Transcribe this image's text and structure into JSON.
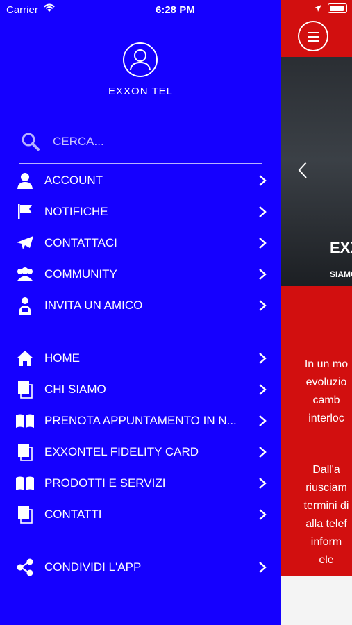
{
  "status": {
    "carrier": "Carrier",
    "time": "6:28 PM"
  },
  "profile": {
    "name": "EXXON TEL"
  },
  "search": {
    "placeholder": "CERCA..."
  },
  "menu": [
    {
      "label": "ACCOUNT",
      "icon": "user-icon"
    },
    {
      "label": "NOTIFICHE",
      "icon": "flag-icon"
    },
    {
      "label": "CONTATTACI",
      "icon": "paper-plane-icon"
    },
    {
      "label": "COMMUNITY",
      "icon": "users-icon"
    },
    {
      "label": "INVITA UN AMICO",
      "icon": "invite-friend-icon"
    },
    {
      "label": "HOME",
      "icon": "home-icon"
    },
    {
      "label": "CHI SIAMO",
      "icon": "pages-icon"
    },
    {
      "label": "PRENOTA APPUNTAMENTO IN N...",
      "icon": "book-icon"
    },
    {
      "label": "EXXONTEL FIDELITY CARD",
      "icon": "pages-icon"
    },
    {
      "label": "PRODOTTI E SERVIZI",
      "icon": "book-icon"
    },
    {
      "label": "CONTATTI",
      "icon": "pages-icon"
    },
    {
      "label": "CONDIVIDI L'APP",
      "icon": "share-icon"
    }
  ],
  "content": {
    "banner_title": "EXX",
    "banner_sub": "SIAMO",
    "para1": [
      "In un mo",
      "evoluzio",
      "camb",
      "interloc"
    ],
    "para2": [
      "Dall'a",
      "riusciam",
      "termini di",
      "alla telef",
      "inform",
      "ele"
    ]
  },
  "colors": {
    "drawer": "#1500ff",
    "content": "#d20f0f"
  }
}
